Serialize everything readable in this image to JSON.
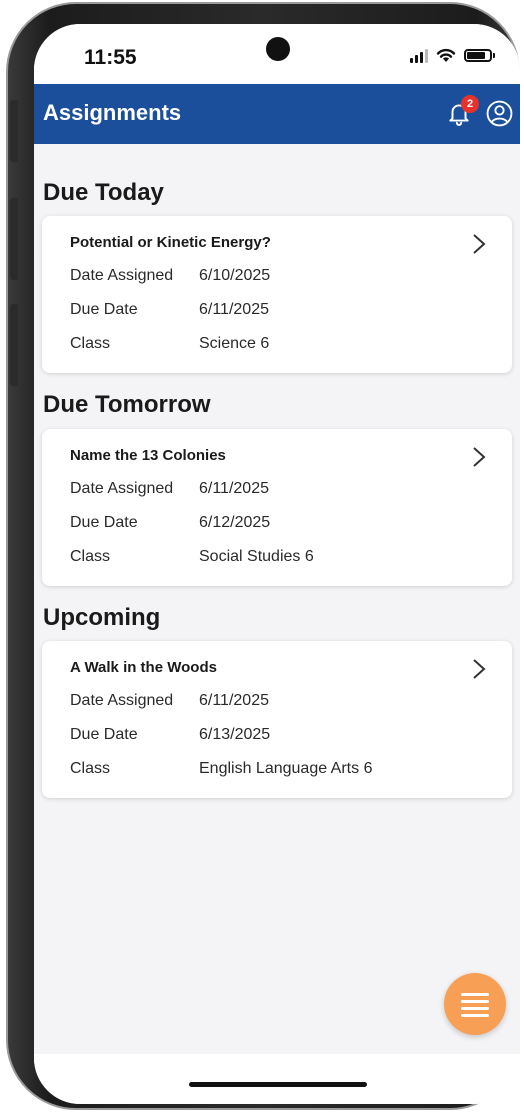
{
  "status_bar": {
    "time": "11:55"
  },
  "header": {
    "title": "Assignments",
    "notification_count": "2"
  },
  "sections": [
    {
      "heading": "Due Today",
      "assignment": {
        "title": "Potential or Kinetic Energy?",
        "date_assigned_label": "Date Assigned",
        "date_assigned": "6/10/2025",
        "due_date_label": "Due Date",
        "due_date": "6/11/2025",
        "class_label": "Class",
        "class": "Science 6"
      }
    },
    {
      "heading": "Due Tomorrow",
      "assignment": {
        "title": "Name the 13 Colonies",
        "date_assigned_label": "Date Assigned",
        "date_assigned": "6/11/2025",
        "due_date_label": "Due Date",
        "due_date": "6/12/2025",
        "class_label": "Class",
        "class": "Social Studies 6"
      }
    },
    {
      "heading": "Upcoming",
      "assignment": {
        "title": "A Walk in the Woods",
        "date_assigned_label": "Date Assigned",
        "date_assigned": "6/11/2025",
        "due_date_label": "Due Date",
        "due_date": "6/13/2025",
        "class_label": "Class",
        "class": "English Language Arts 6"
      }
    }
  ],
  "colors": {
    "header_bg": "#1b4e9b",
    "badge": "#e5322d",
    "fab": "#f7a055",
    "screen_bg": "#f4f4f6"
  },
  "icons": {
    "notifications": "bell-icon",
    "profile": "user-circle-icon",
    "card_open": "chevron-right-icon",
    "menu": "hamburger-menu-icon"
  }
}
